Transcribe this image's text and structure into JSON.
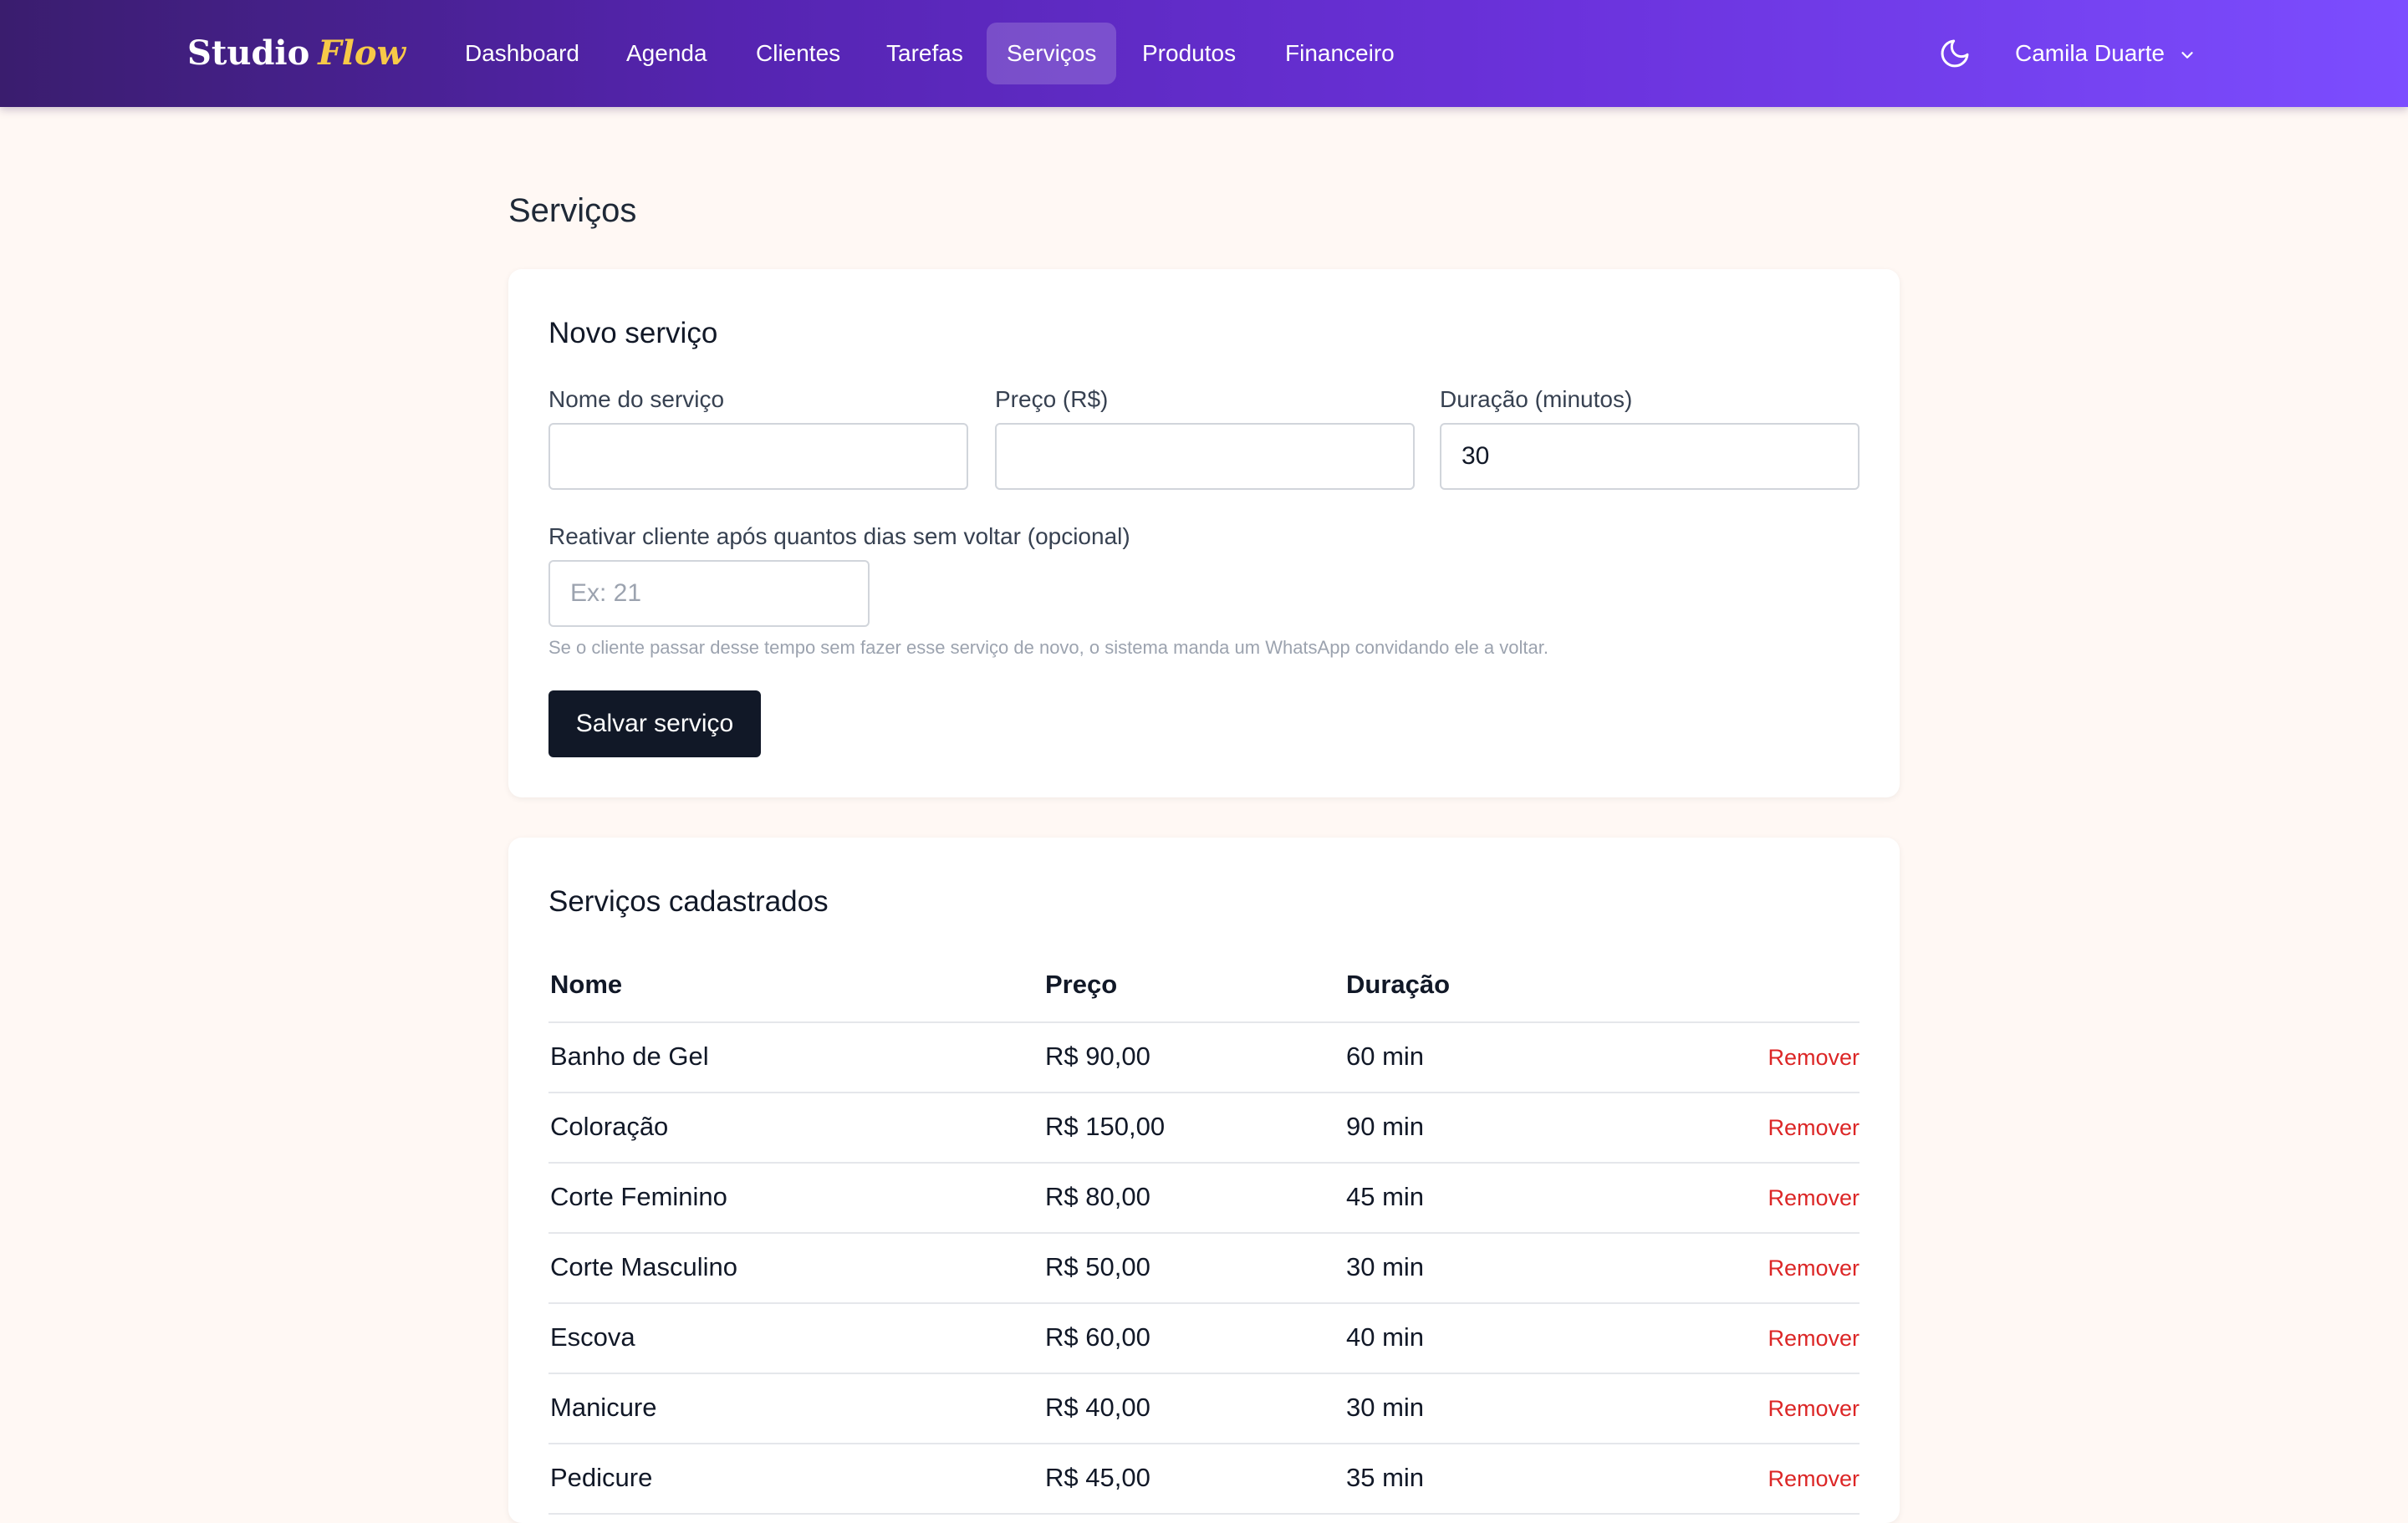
{
  "app": {
    "brand_main": "Studio",
    "brand_accent": "Flow",
    "brand_accent_color": "#f7c948"
  },
  "nav": {
    "items": [
      {
        "label": "Dashboard"
      },
      {
        "label": "Agenda"
      },
      {
        "label": "Clientes"
      },
      {
        "label": "Tarefas"
      },
      {
        "label": "Serviços",
        "active": true
      },
      {
        "label": "Produtos"
      },
      {
        "label": "Financeiro"
      }
    ],
    "theme_icon": "moon-icon",
    "user_name": "Camila Duarte",
    "user_menu_icon": "chevron-down-icon"
  },
  "page": {
    "title": "Serviços"
  },
  "form": {
    "title": "Novo serviço",
    "name_label": "Nome do serviço",
    "name_value": "",
    "price_label": "Preço (R$)",
    "price_value": "",
    "duration_label": "Duração (minutos)",
    "duration_value": "30",
    "reactivate_label": "Reativar cliente após quantos dias sem voltar (opcional)",
    "reactivate_placeholder": "Ex: 21",
    "reactivate_hint": "Se o cliente passar desse tempo sem fazer esse serviço de novo, o sistema manda um WhatsApp convidando ele a voltar.",
    "save_label": "Salvar serviço"
  },
  "list": {
    "title": "Serviços cadastrados",
    "columns": {
      "name": "Nome",
      "price": "Preço",
      "duration": "Duração"
    },
    "remove_label": "Remover",
    "remove_color": "#dc2626",
    "rows": [
      {
        "name": "Banho de Gel",
        "price": "R$ 90,00",
        "duration": "60 min"
      },
      {
        "name": "Coloração",
        "price": "R$ 150,00",
        "duration": "90 min"
      },
      {
        "name": "Corte Feminino",
        "price": "R$ 80,00",
        "duration": "45 min"
      },
      {
        "name": "Corte Masculino",
        "price": "R$ 50,00",
        "duration": "30 min"
      },
      {
        "name": "Escova",
        "price": "R$ 60,00",
        "duration": "40 min"
      },
      {
        "name": "Manicure",
        "price": "R$ 40,00",
        "duration": "30 min"
      },
      {
        "name": "Pedicure",
        "price": "R$ 45,00",
        "duration": "35 min"
      }
    ]
  }
}
